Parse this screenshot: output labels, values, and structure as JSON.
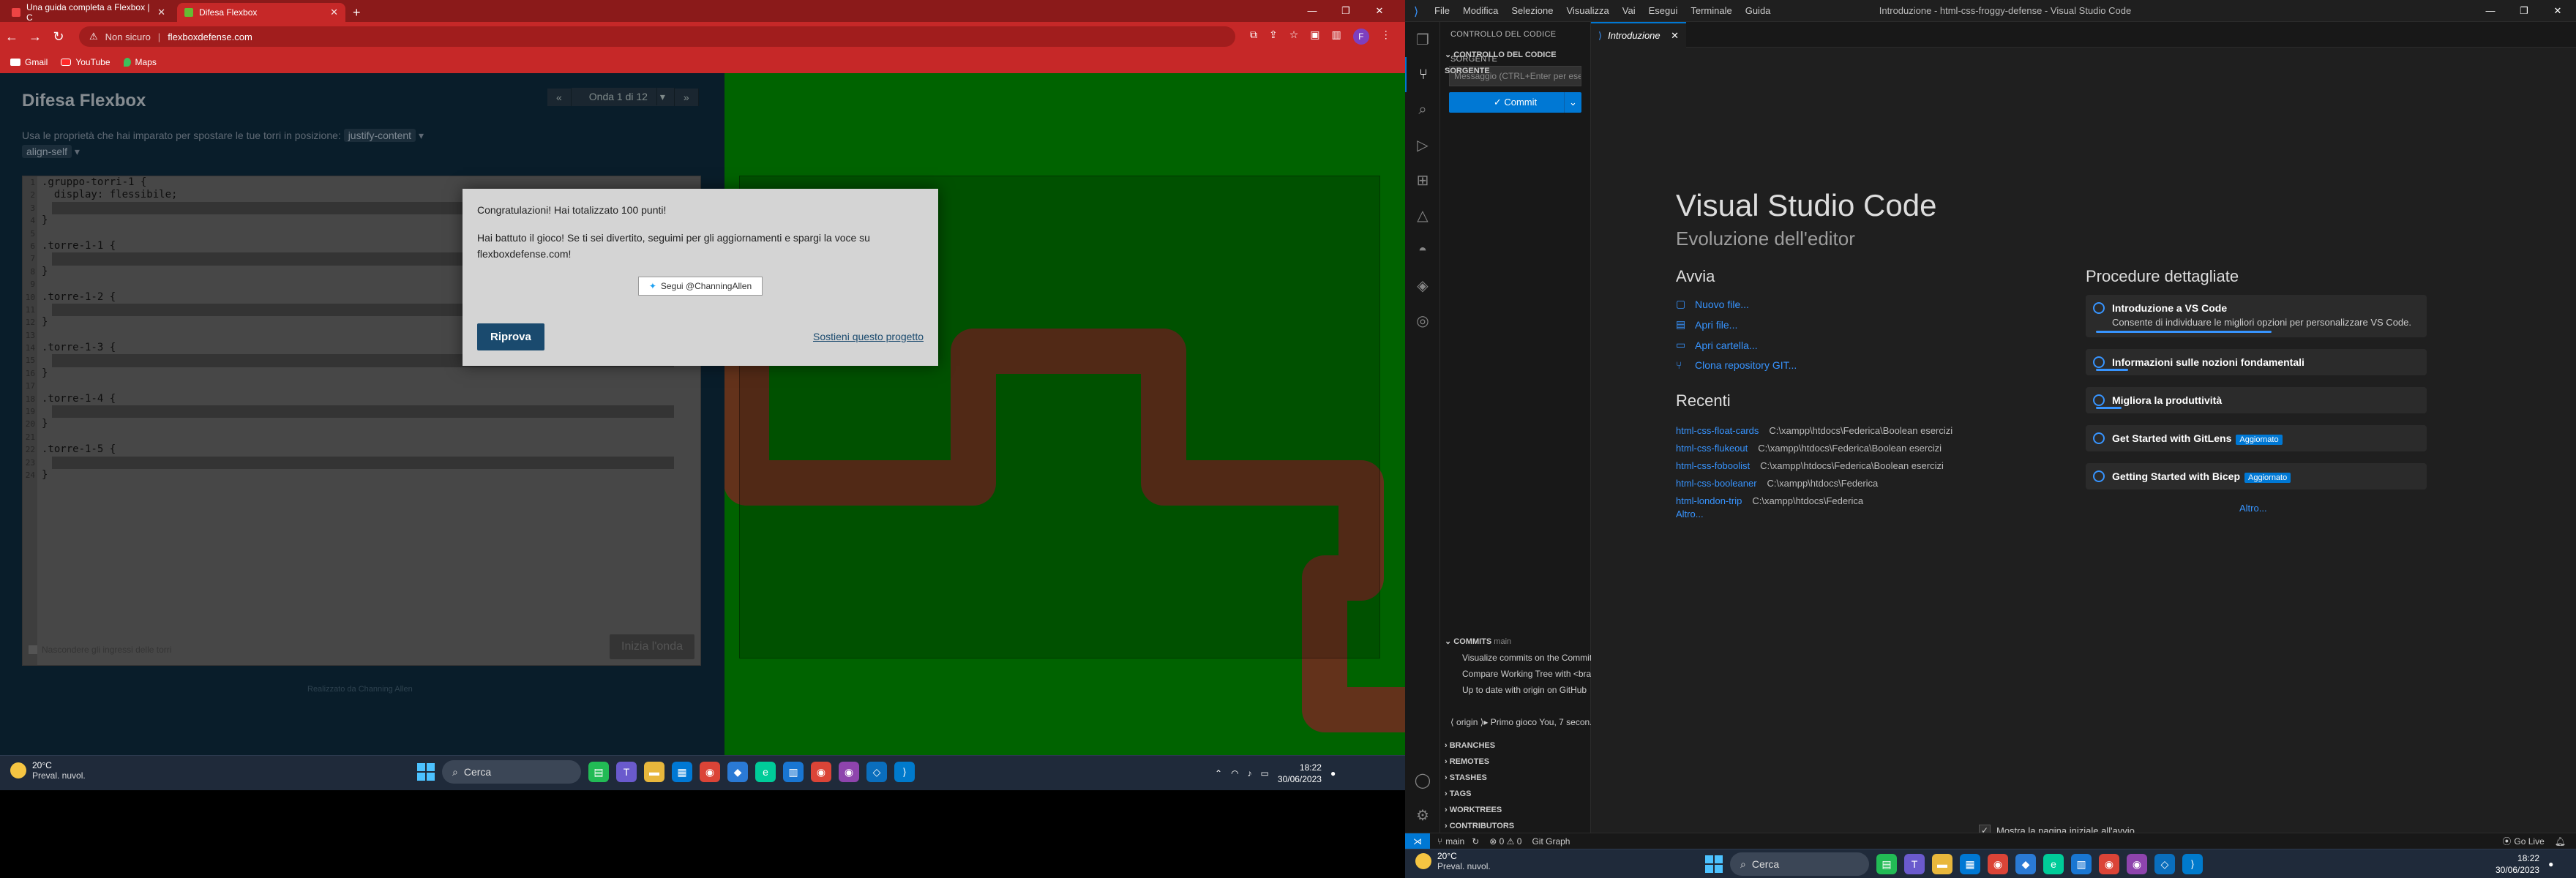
{
  "browser": {
    "tabs": [
      {
        "label": "Una guida completa a Flexbox | C"
      },
      {
        "label": "Difesa Flexbox"
      }
    ],
    "address": {
      "security": "Non sicuro",
      "host": "flexboxdefense.com"
    },
    "profile_initial": "F",
    "bookmarks": [
      {
        "label": "Gmail"
      },
      {
        "label": "YouTube"
      },
      {
        "label": "Maps"
      }
    ]
  },
  "game": {
    "title": "Difesa Flexbox",
    "level": "Onda 1 di 12",
    "instructions": "Usa le proprietà che hai imparato per spostare le tue torri in posizione:",
    "keywords": [
      "justify-content",
      "align-self"
    ],
    "code_lines": [
      ".gruppo-torri-1 {",
      "  display: flessibile;",
      "",
      "}",
      "",
      ".torre-1-1 {",
      "",
      "}",
      "",
      ".torre-1-2 {",
      "",
      "}",
      "",
      ".torre-1-3 {",
      "",
      "}",
      "",
      ".torre-1-4 {",
      "",
      "}",
      "",
      ".torre-1-5 {",
      "",
      "}"
    ],
    "line_numbers": [
      "1",
      "2",
      "3",
      "4",
      "5",
      "6",
      "7",
      "8",
      "9",
      "10",
      "11",
      "12",
      "13",
      "14",
      "15",
      "16",
      "17",
      "18",
      "19",
      "20",
      "21",
      "22",
      "23",
      "24"
    ],
    "start_button": "Inizia l'onda",
    "show_path": "Nascondere gli ingressi delle torri",
    "credits": "Realizzato da Channing Allen"
  },
  "modal": {
    "congrats": "Congratulazioni! Hai totalizzato 100 punti!",
    "message": "Hai battuto il gioco! Se ti sei divertito, seguimi per gli aggiornamenti e spargi la voce su flexboxdefense.com!",
    "follow": "Segui @ChanningAllen",
    "retry": "Riprova",
    "support": "Sostieni questo progetto"
  },
  "taskbar_left": {
    "temp": "20°C",
    "weather": "Preval. nuvol.",
    "search": "Cerca",
    "time": "18:22",
    "date": "30/06/2023"
  },
  "vscode": {
    "menu": [
      "File",
      "Modifica",
      "Selezione",
      "Visualizza",
      "Vai",
      "Esegui",
      "Terminale",
      "Guida"
    ],
    "window_title": "Introduzione - html-css-froggy-defense - Visual Studio Code",
    "sidebar_title": "CONTROLLO DEL CODICE SORGENTE",
    "scm_section": "CONTROLLO DEL CODICE SORGENTE",
    "commit_placeholder": "Messaggio (CTRL+Enter per eseguire il c...",
    "commit_button": "✓ Commit",
    "commits_header": "COMMITS",
    "commits_branch": "main",
    "commit_items": [
      "Visualize commits on the Commit Gr...",
      "Compare Working Tree with <branch...",
      "Up to date with origin on GitHub"
    ],
    "origin_item": "⟨ origin ⟩▸ Primo gioco  You, 7 secon...",
    "sections": [
      "BRANCHES",
      "REMOTES",
      "STASHES",
      "TAGS",
      "WORKTREES",
      "CONTRIBUTORS"
    ],
    "tab": "Introduzione",
    "welcome_title": "Visual Studio Code",
    "welcome_subtitle": "Evoluzione dell'editor",
    "start_heading": "Avvia",
    "start_links": [
      "Nuovo file...",
      "Apri file...",
      "Apri cartella...",
      "Clona repository GIT..."
    ],
    "recent_heading": "Recenti",
    "recent": [
      {
        "name": "html-css-float-cards",
        "path": "C:\\xampp\\htdocs\\Federica\\Boolean esercizi"
      },
      {
        "name": "html-css-flukeout",
        "path": "C:\\xampp\\htdocs\\Federica\\Boolean esercizi"
      },
      {
        "name": "html-css-foboolist",
        "path": "C:\\xampp\\htdocs\\Federica\\Boolean esercizi"
      },
      {
        "name": "html-css-booleaner",
        "path": "C:\\xampp\\htdocs\\Federica"
      },
      {
        "name": "html-london-trip",
        "path": "C:\\xampp\\htdocs\\Federica"
      }
    ],
    "recent_more": "Altro...",
    "walk_heading": "Procedure dettagliate",
    "walkthroughs": [
      {
        "title": "Introduzione a VS Code",
        "desc": "Consente di individuare le migliori opzioni per personalizzare VS Code.",
        "badge": "",
        "progress": 0.55
      },
      {
        "title": "Informazioni sulle nozioni fondamentali",
        "desc": "",
        "badge": "",
        "progress": 0.1
      },
      {
        "title": "Migliora la produttività",
        "desc": "",
        "badge": "",
        "progress": 0.08
      },
      {
        "title": "Get Started with GitLens",
        "desc": "",
        "badge": "Aggiornato",
        "progress": 0
      },
      {
        "title": "Getting Started with Bicep",
        "desc": "",
        "badge": "Aggiornato",
        "progress": 0
      }
    ],
    "walk_more": "Altro...",
    "show_on_start": "Mostra la pagina iniziale all'avvio",
    "status": {
      "branch": "main",
      "problems": "⊗ 0 ⚠ 0",
      "git_graph": "Git Graph",
      "golive": "Go Live"
    }
  },
  "taskbar_right": {
    "temp": "20°C",
    "weather": "Preval. nuvol.",
    "search": "Cerca",
    "time": "18:22",
    "date": "30/06/2023"
  }
}
